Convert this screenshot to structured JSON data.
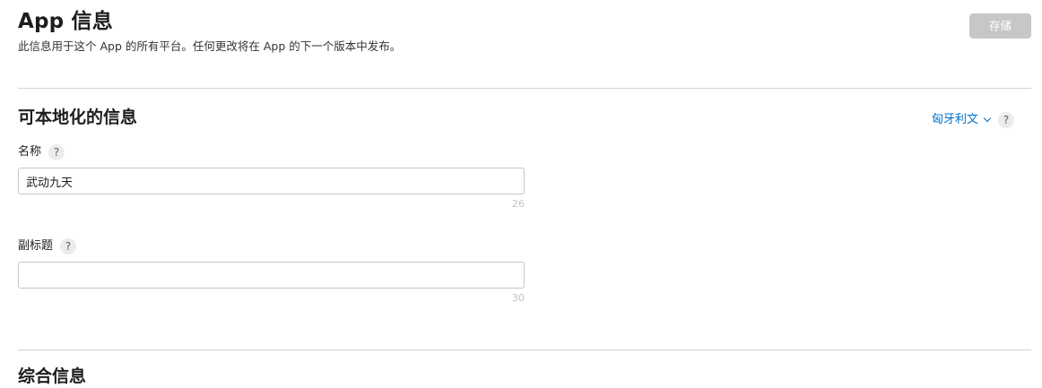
{
  "header": {
    "title": "App 信息",
    "description": "此信息用于这个 App 的所有平台。任何更改将在 App 的下一个版本中发布。",
    "save_label": "存储"
  },
  "localizable": {
    "title": "可本地化的信息",
    "language": "匈牙利文",
    "help_glyph": "?",
    "fields": [
      {
        "label": "名称",
        "value": "武动九天",
        "placeholder": "",
        "remaining": "26"
      },
      {
        "label": "副标题",
        "value": "",
        "placeholder": "",
        "remaining": "30"
      }
    ]
  },
  "next_section": {
    "title": "综合信息"
  },
  "colors": {
    "accent": "#0070c9",
    "disabled_button": "#c7c7c9"
  }
}
